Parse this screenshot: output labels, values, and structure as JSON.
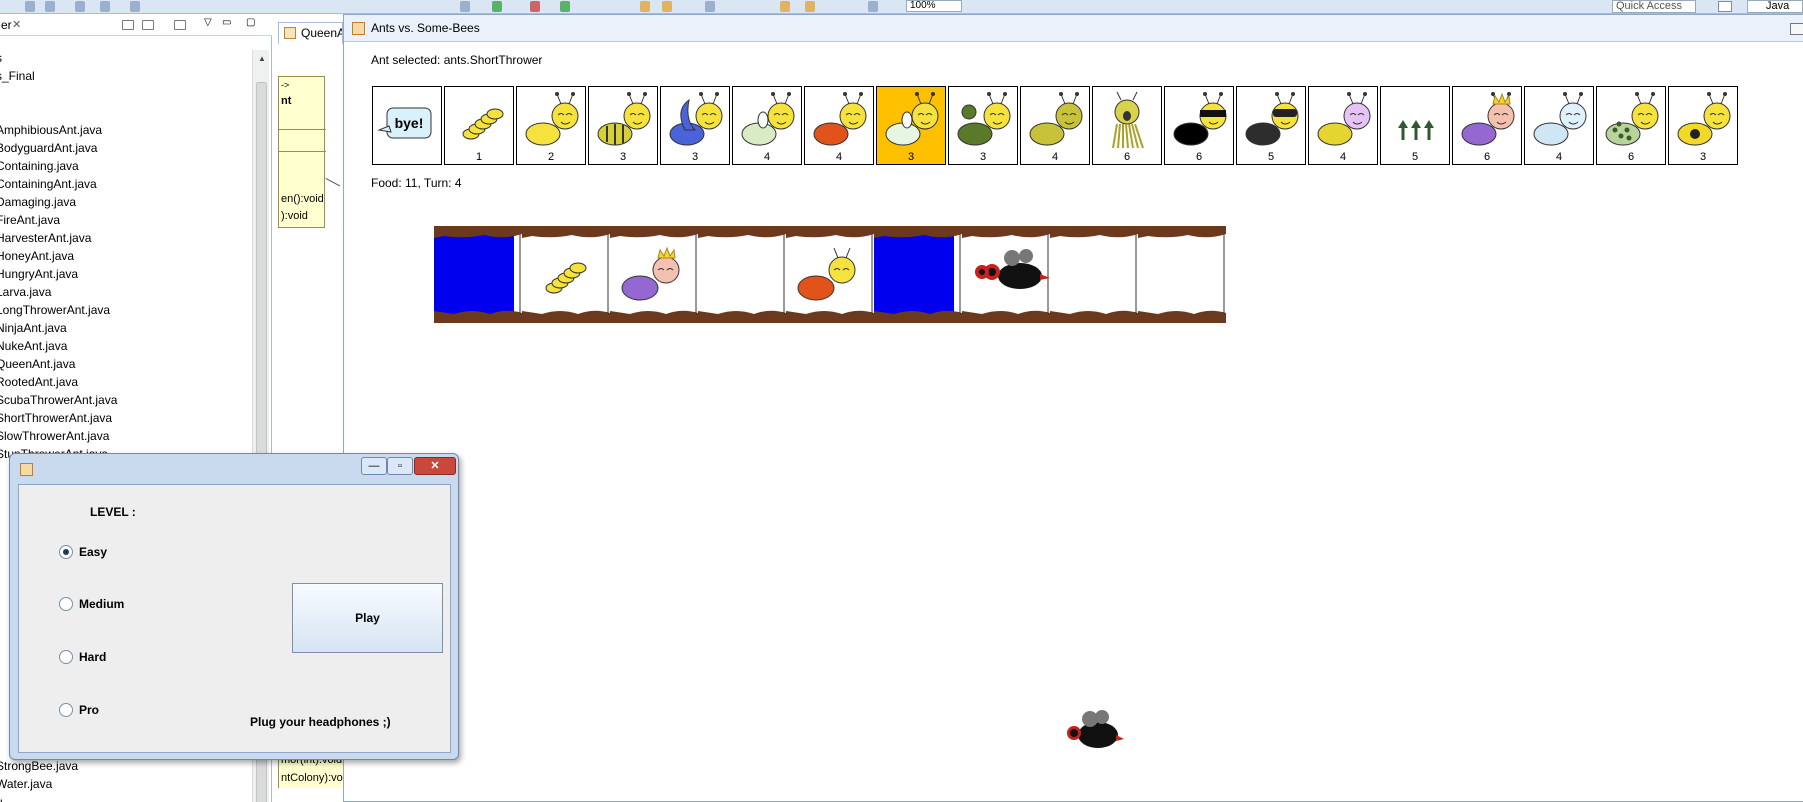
{
  "ide": {
    "zoom": "100%",
    "quick_access": "Quick Access",
    "perspective": "Java",
    "explorer_tab": "er",
    "editor_tab": "QueenA",
    "uml_lines": [
      "->",
      "nt",
      "en():void",
      "):void"
    ],
    "uml_bottom_lines": [
      "mor(int):void",
      "ntColony):void"
    ],
    "tree_items": [
      "s",
      "s_Final",
      "AmphibiousAnt.java",
      "BodyguardAnt.java",
      "Containing.java",
      "ContainingAnt.java",
      "Damaging.java",
      "FireAnt.java",
      "HarvesterAnt.java",
      "HoneyAnt.java",
      "HungryAnt.java",
      "Larva.java",
      "LongThrowerAnt.java",
      "NinjaAnt.java",
      "NukeAnt.java",
      "QueenAnt.java",
      "RootedAnt.java",
      "ScubaThrowerAnt.java",
      "ShortThrowerAnt.java",
      "SlowThrowerAnt.java",
      "StunThrowerAnt.java"
    ],
    "tree_items_bottom": [
      "StrongBee.java",
      "Water.java",
      "u"
    ]
  },
  "game": {
    "title": "Ants vs. Some-Bees",
    "ant_selected": "Ant selected: ants.ShortThrower",
    "status": "Food: 11, Turn: 4",
    "cards": [
      {
        "cost": "",
        "icon": "bye-icon",
        "color": "#ffffff",
        "selected": false
      },
      {
        "cost": "1",
        "icon": "larva-icon",
        "color": "#f5e23c",
        "selected": false
      },
      {
        "cost": "2",
        "icon": "harvester-ant-icon",
        "color": "#f5e23c",
        "selected": false
      },
      {
        "cost": "3",
        "icon": "bee-striped-ant-icon",
        "color": "#d6cf3a",
        "selected": false
      },
      {
        "cost": "3",
        "icon": "scuba-ant-icon",
        "color": "#4a63d8",
        "selected": false
      },
      {
        "cost": "4",
        "icon": "thrower-ant-icon",
        "color": "#d9ebc2",
        "selected": false
      },
      {
        "cost": "4",
        "icon": "fire-ant-icon",
        "color": "#e2531c",
        "selected": false
      },
      {
        "cost": "3",
        "icon": "short-thrower-ant-icon",
        "color": "#e6f6e0",
        "selected": true
      },
      {
        "cost": "3",
        "icon": "long-thrower-ant-icon",
        "color": "#5a7a2a",
        "selected": false
      },
      {
        "cost": "4",
        "icon": "wall-ant-icon",
        "color": "#c8c23a",
        "selected": false
      },
      {
        "cost": "6",
        "icon": "hungry-ant-icon",
        "color": "#d9d34a",
        "selected": false
      },
      {
        "cost": "6",
        "icon": "ninja-ant-icon",
        "color": "#000000",
        "selected": false
      },
      {
        "cost": "5",
        "icon": "bodyguard-ant-icon",
        "color": "#2d2d2d",
        "selected": false
      },
      {
        "cost": "4",
        "icon": "honey-ant-icon",
        "color": "#e6d430",
        "selected": false
      },
      {
        "cost": "5",
        "icon": "rooted-ant-icon",
        "color": "#2f5a2f",
        "selected": false
      },
      {
        "cost": "6",
        "icon": "queen-ant-icon",
        "color": "#9467d1",
        "selected": false
      },
      {
        "cost": "4",
        "icon": "slow-ant-icon",
        "color": "#cfe7f5",
        "selected": false
      },
      {
        "cost": "6",
        "icon": "stun-ant-icon",
        "color": "#b7d59a",
        "selected": false
      },
      {
        "cost": "3",
        "icon": "nuke-ant-icon",
        "color": "#f2d928",
        "selected": false
      }
    ],
    "tunnel": [
      {
        "kind": "water"
      },
      {
        "kind": "larva"
      },
      {
        "kind": "queen"
      },
      {
        "kind": "empty"
      },
      {
        "kind": "fire"
      },
      {
        "kind": "water"
      },
      {
        "kind": "bees"
      },
      {
        "kind": "empty"
      },
      {
        "kind": "empty"
      }
    ]
  },
  "dialog": {
    "level_label": "LEVEL :",
    "options": [
      {
        "label": "Easy",
        "selected": true
      },
      {
        "label": "Medium",
        "selected": false
      },
      {
        "label": "Hard",
        "selected": false
      },
      {
        "label": "Pro",
        "selected": false
      }
    ],
    "play_label": "Play",
    "hint": "Plug your headphones ;)",
    "btn_minimize": "—",
    "btn_maximize": "▫",
    "btn_close": "✕"
  }
}
